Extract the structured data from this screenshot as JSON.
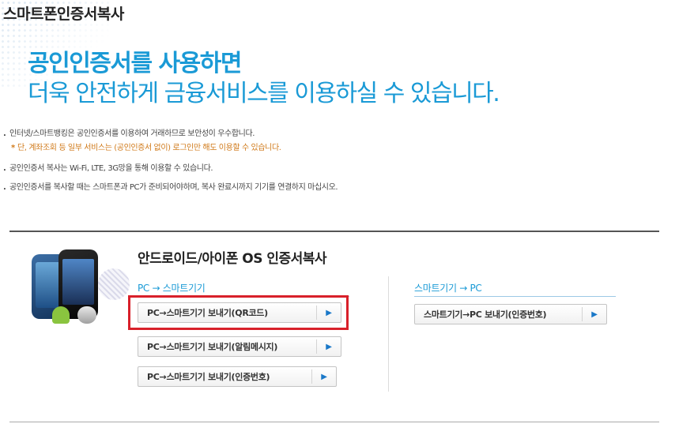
{
  "page": {
    "title": "스마트폰인증서복사"
  },
  "hero": {
    "line1": "공인인증서를 사용하면",
    "line2": "더욱 안전하게 금융서비스를 이용하실 수 있습니다."
  },
  "notes": [
    {
      "bullet": ".",
      "text": "인터넷/스마트뱅킹은 공인인증서를 이용하여 거래하므로 보안성이 우수합니다."
    },
    {
      "bullet": "*",
      "text": "단, 계좌조회 등 일부 서비스는 (공인인증서 없이) 로그인만 해도 이용할 수 있습니다."
    },
    {
      "bullet": ".",
      "text": "공인인증서 복사는 Wi-Fi, LTE, 3G망을 통해 이용할 수 있습니다."
    },
    {
      "bullet": ".",
      "text": "공인인증서를 복사할 때는 스마트폰과 PC가 준비되어야하며, 복사 완료시까지 기기를 연결하지 마십시오."
    }
  ],
  "section": {
    "title": "안드로이드/아이폰 OS 인증서복사",
    "pc_to_phone": {
      "label": "PC → 스마트기기",
      "buttons": [
        {
          "label": "PC→스마트기기 보내기(QR코드)",
          "icon": "play-arrow-icon"
        },
        {
          "label": "PC→스마트기기 보내기(알림메시지)",
          "icon": "play-arrow-icon"
        },
        {
          "label": "PC→스마트기기 보내기(인증번호)",
          "icon": "play-arrow-icon"
        }
      ]
    },
    "phone_to_pc": {
      "label": "스마트기기 → PC",
      "buttons": [
        {
          "label": "스마트기기→PC 보내기(인증번호)",
          "icon": "play-arrow-icon"
        }
      ]
    }
  },
  "colors": {
    "accent": "#1a9ad6",
    "highlight": "#d8202a",
    "note_orange": "#d07a1a"
  }
}
